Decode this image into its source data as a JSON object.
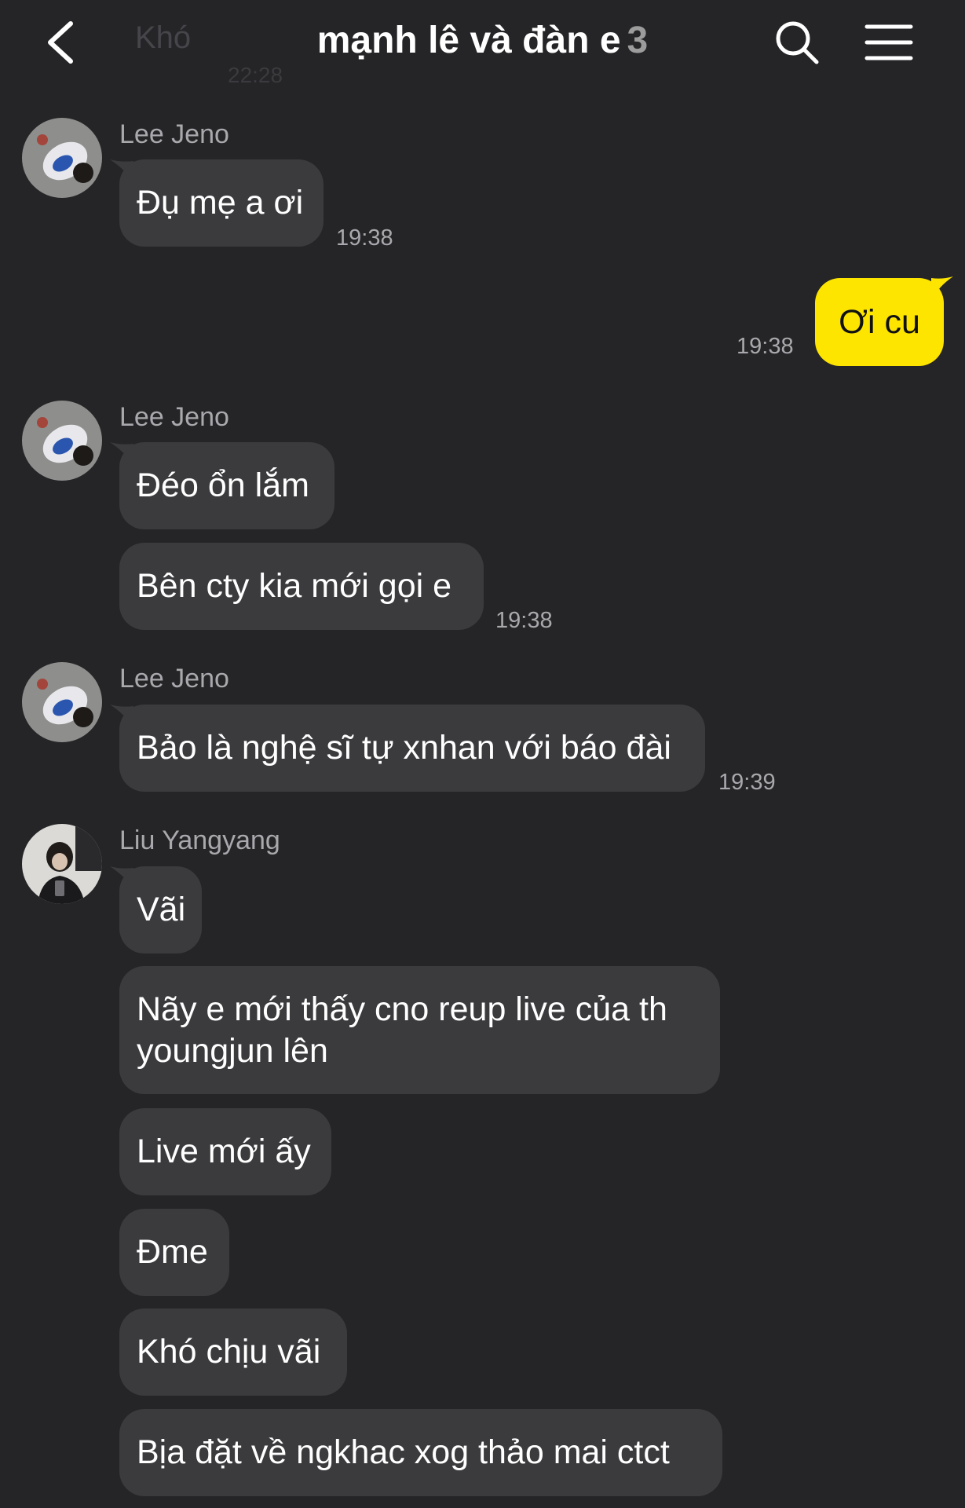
{
  "header": {
    "title": "mạnh lê và đàn e",
    "member_count": "3",
    "back_icon": "chevron-left-icon",
    "search_icon": "search-icon",
    "menu_icon": "hamburger-menu-icon",
    "background_text": "Khó",
    "background_time": "22:28"
  },
  "colors": {
    "background": "#252528",
    "incoming_bubble": "#3b3b3e",
    "outgoing_bubble": "#fee500",
    "secondary_text": "#a9a9ad"
  },
  "messages": [
    {
      "sender": "Lee Jeno",
      "bubbles": [
        "Đụ mẹ a ơi"
      ],
      "time": "19:38"
    },
    {
      "sender": "me",
      "bubbles": [
        "Ơi cu"
      ],
      "time": "19:38"
    },
    {
      "sender": "Lee Jeno",
      "bubbles": [
        "Đéo ổn lắm",
        "Bên cty kia mới gọi e"
      ],
      "time": "19:38"
    },
    {
      "sender": "Lee Jeno",
      "bubbles": [
        "Bảo là nghệ sĩ tự xnhan với báo đài"
      ],
      "time": "19:39"
    },
    {
      "sender": "Liu Yangyang",
      "bubbles": [
        "Vãi",
        "Nãy e mới thấy cno reup live của th youngjun lên",
        "Live mới ấy",
        "Đme",
        "Khó chịu vãi",
        "Bịa đặt về ngkhac xog thảo mai ctct"
      ],
      "time": ""
    }
  ]
}
